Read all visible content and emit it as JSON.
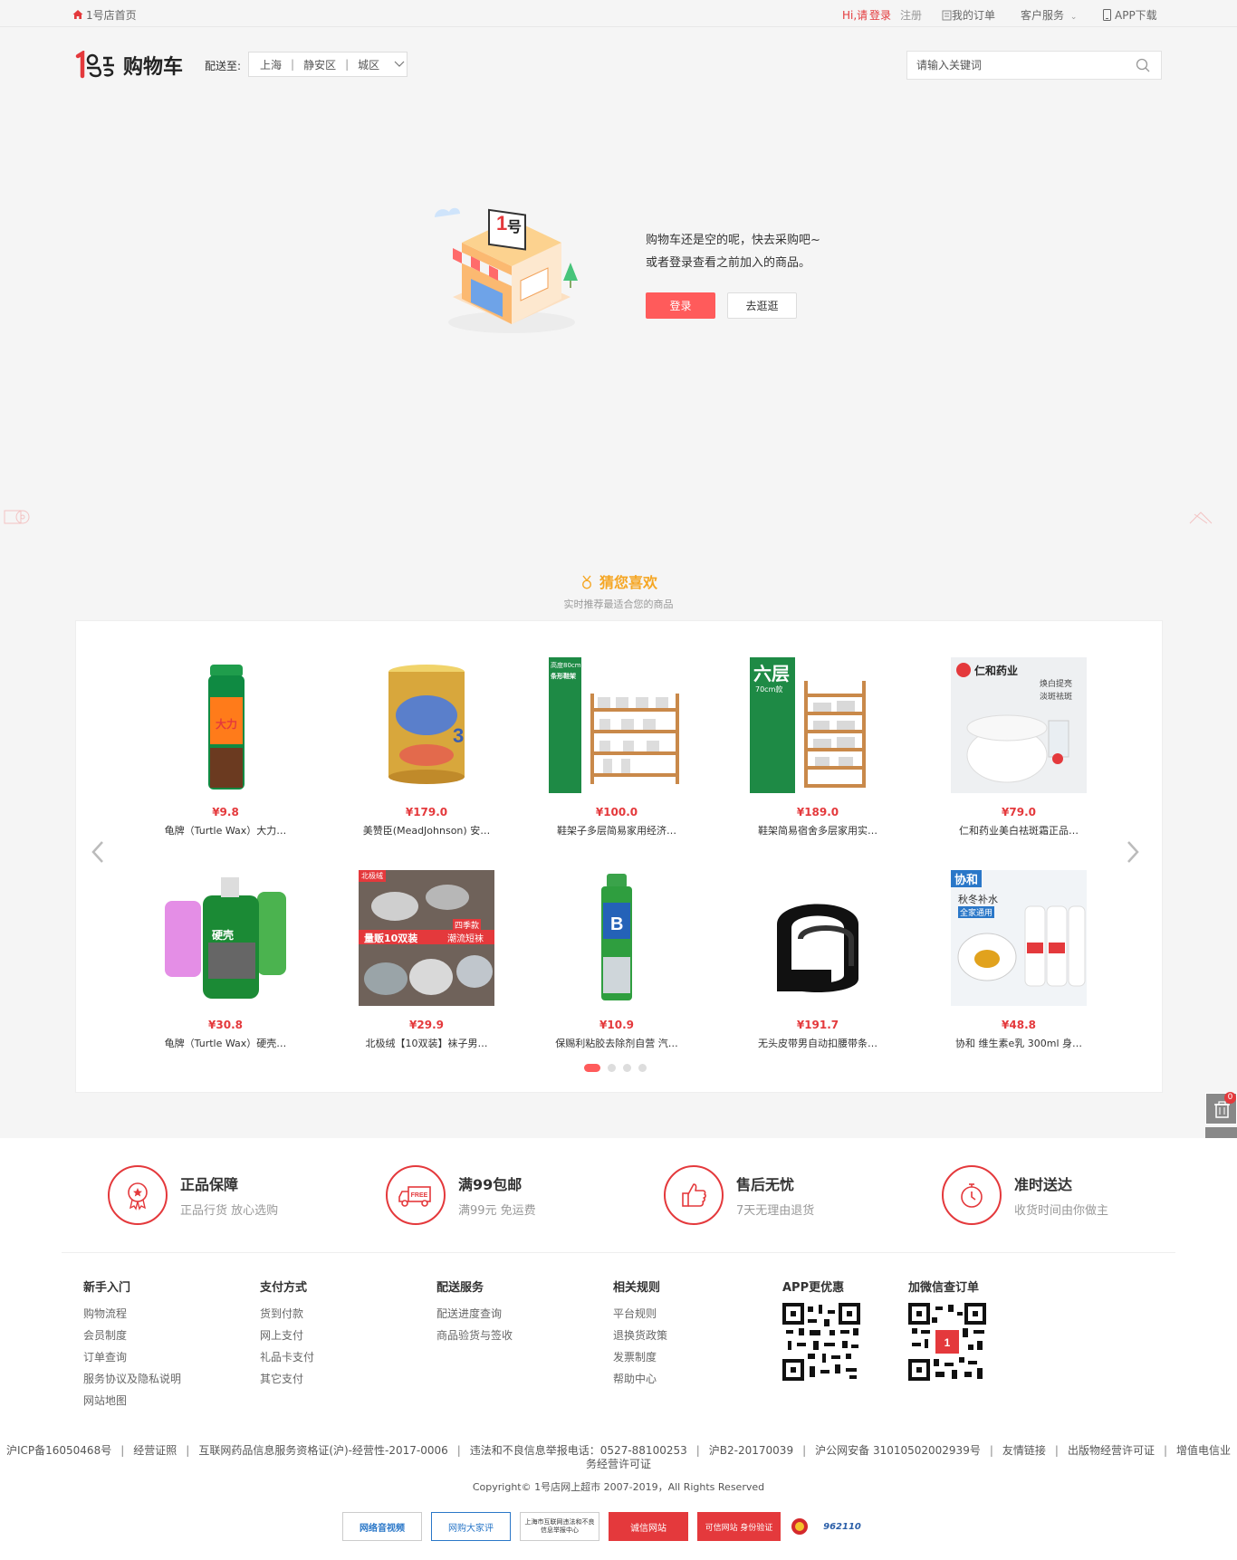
{
  "topbar": {
    "home_link": "1号店首页",
    "greeting": "Hi,请",
    "login": "登录",
    "register": "注册",
    "my_orders": "我的订单",
    "customer_service": "客户服务",
    "app_download": "APP下载"
  },
  "header": {
    "logo_text": "购物车",
    "ship_to_label": "配送至:",
    "province": "上海",
    "district": "静安区",
    "area": "城区",
    "search_placeholder": "请输入关键词"
  },
  "empty_cart": {
    "message_line1": "购物车还是空的呢，快去采购吧~",
    "message_line2": "或者登录查看之前加入的商品。",
    "login_button": "登录",
    "shop_button": "去逛逛"
  },
  "recommend": {
    "title": "猜您喜欢",
    "subtitle": "实时推荐最适合您的商品",
    "products": [
      {
        "price": "¥9.8",
        "name": "龟牌（Turtle Wax）大力…"
      },
      {
        "price": "¥179.0",
        "name": "美赞臣(MeadJohnson) 安…"
      },
      {
        "price": "¥100.0",
        "name": "鞋架子多层简易家用经济…"
      },
      {
        "price": "¥189.0",
        "name": "鞋架简易宿舍多层家用实…"
      },
      {
        "price": "¥79.0",
        "name": "仁和药业美白祛斑霜正品…"
      },
      {
        "price": "¥30.8",
        "name": "龟牌（Turtle Wax）硬壳…"
      },
      {
        "price": "¥29.9",
        "name": "北极绒【10双装】袜子男…"
      },
      {
        "price": "¥10.9",
        "name": "保赐利粘胶去除剂自营 汽…"
      },
      {
        "price": "¥191.7",
        "name": "无头皮带男自动扣腰带条…"
      },
      {
        "price": "¥48.8",
        "name": "协和 维生素e乳 300ml 身…"
      }
    ],
    "image_texts": {
      "p3_a": "高度80cm",
      "p3_b": "条形鞋架",
      "p4_a": "六层",
      "p4_b": "70cm款",
      "p5_a": "仁和药业",
      "p5_b": "焕白提亮",
      "p5_c": "淡斑祛斑",
      "p7_a": "北极绒",
      "p7_b": "量贩10双装",
      "p7_c": "四季款",
      "p7_d": "潮流短袜",
      "p10_a": "协和",
      "p10_b": "秋冬补水",
      "p10_c": "全家通用"
    }
  },
  "side": {
    "cart_count": "0"
  },
  "guarantees": [
    {
      "title": "正品保障",
      "desc": "正品行货 放心选购"
    },
    {
      "title": "满99包邮",
      "desc": "满99元 免运费",
      "icon_text": "FREE"
    },
    {
      "title": "售后无忧",
      "desc": "7天无理由退货"
    },
    {
      "title": "准时送达",
      "desc": "收货时间由你做主"
    }
  ],
  "footer": {
    "col1": {
      "title": "新手入门",
      "links": [
        "购物流程",
        "会员制度",
        "订单查询",
        "服务协议及隐私说明",
        "网站地图"
      ]
    },
    "col2": {
      "title": "支付方式",
      "links": [
        "货到付款",
        "网上支付",
        "礼品卡支付",
        "其它支付"
      ]
    },
    "col3": {
      "title": "配送服务",
      "links": [
        "配送进度查询",
        "商品验货与签收"
      ]
    },
    "col4": {
      "title": "相关规则",
      "links": [
        "平台规则",
        "退换货政策",
        "发票制度",
        "帮助中心"
      ]
    },
    "app_title": "APP更优惠",
    "wechat_title": "加微信查订单",
    "legal": [
      "沪ICP备16050468号",
      "经营证照",
      "互联网药品信息服务资格证(沪)-经营性-2017-0006",
      "违法和不良信息举报电话：0527-88100253",
      "沪B2-20170039",
      "沪公网安备 31010502002939号",
      "友情链接",
      "出版物经营许可证",
      "增值电信业"
    ],
    "legal_wrap": "务经营许可证",
    "copyright": "Copyright© 1号店网上超市 2007-2019，All Rights Reserved",
    "badges": [
      "网络音视频",
      "网购大家评",
      "上海市互联网违法和不良信息举报中心",
      "诚信网站",
      "可信网站 身份验证",
      "962110"
    ]
  }
}
